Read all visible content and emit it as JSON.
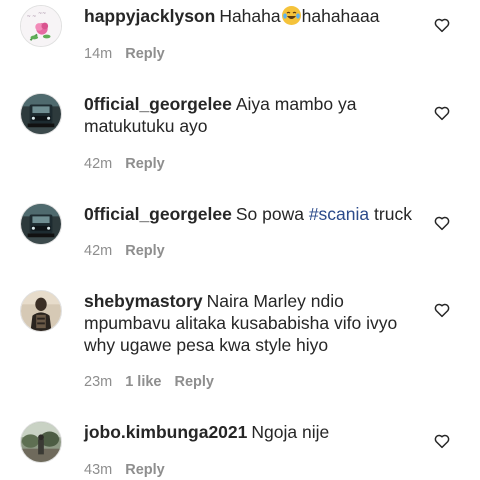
{
  "comments": [
    {
      "username": "happyjacklyson",
      "text_before": "Hahaha",
      "emoji": "face-with-tears-of-joy-icon",
      "text_after": "hahahaaa",
      "time": "14m",
      "reply_label": "Reply",
      "avatar": "pink-rose-avatar"
    },
    {
      "username": "0fficial_georgelee",
      "text": "Aiya mambo ya matukutuku ayo",
      "time": "42m",
      "reply_label": "Reply",
      "avatar": "truck-avatar"
    },
    {
      "username": "0fficial_georgelee",
      "text_before": "So powa ",
      "hashtag": "#scania",
      "text_after": " truck",
      "time": "42m",
      "reply_label": "Reply",
      "avatar": "truck-avatar"
    },
    {
      "username": "shebymastory",
      "text": "Naira Marley ndio mpumbavu alitaka kusababisha vifo ivyo why ugawe pesa kwa style hiyo",
      "time": "23m",
      "likes_label": "1 like",
      "reply_label": "Reply",
      "avatar": "person-avatar"
    },
    {
      "username": "jobo.kimbunga2021",
      "text": "Ngoja nije",
      "time": "43m",
      "reply_label": "Reply",
      "avatar": "outdoor-avatar"
    }
  ],
  "colors": {
    "text": "#262626",
    "meta": "#8e8e8e",
    "hashtag": "#2b4a8a",
    "icon": "#262626"
  },
  "icons": {
    "like": "heart-outline-icon"
  }
}
